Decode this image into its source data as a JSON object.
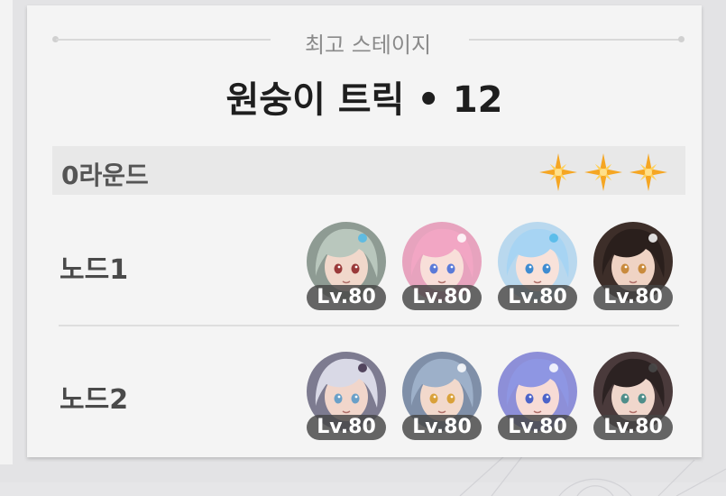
{
  "card": {
    "sub_header": "최고 스테이지",
    "title": "원숭이 트릭 • 12",
    "round": {
      "label": "0라운드",
      "stars_earned": 3,
      "stars_total": 3,
      "star_color": "#f5a623"
    },
    "nodes": [
      {
        "label": "노드1",
        "characters": [
          {
            "level": "Lv.80",
            "bg": "#8e9b93",
            "hair": "#b9c7bd",
            "skin": "#f1d8cb",
            "eye": "#9a3a3a",
            "accent": "#4fb8e8"
          },
          {
            "level": "Lv.80",
            "bg": "#e7a3be",
            "hair": "#f2a6c4",
            "skin": "#f8dfd9",
            "eye": "#5a7ad8",
            "accent": "#ffffff"
          },
          {
            "level": "Lv.80",
            "bg": "#b9d8ee",
            "hair": "#a7d4f3",
            "skin": "#f8e2da",
            "eye": "#3f8cd1",
            "accent": "#4fb8e8"
          },
          {
            "level": "Lv.80",
            "bg": "#3d2e29",
            "hair": "#2a1f1c",
            "skin": "#efd3c4",
            "eye": "#c98b3d",
            "accent": "#ffffff"
          }
        ]
      },
      {
        "label": "노드2",
        "characters": [
          {
            "level": "Lv.80",
            "bg": "#7d7b90",
            "hair": "#d9d9e6",
            "skin": "#f1d6cb",
            "eye": "#6aa0c8",
            "accent": "#3a2a45"
          },
          {
            "level": "Lv.80",
            "bg": "#7f8fa8",
            "hair": "#9db0c9",
            "skin": "#f2d9cc",
            "eye": "#d9a13a",
            "accent": "#ffffff"
          },
          {
            "level": "Lv.80",
            "bg": "#8d8fd8",
            "hair": "#8e96e3",
            "skin": "#f7dcd6",
            "eye": "#4d64c9",
            "accent": "#ffffff"
          },
          {
            "level": "Lv.80",
            "bg": "#4a3a3b",
            "hair": "#2c2222",
            "skin": "#f0d7cc",
            "eye": "#4f8e8a",
            "accent": "#4a4a4a"
          }
        ]
      }
    ]
  }
}
